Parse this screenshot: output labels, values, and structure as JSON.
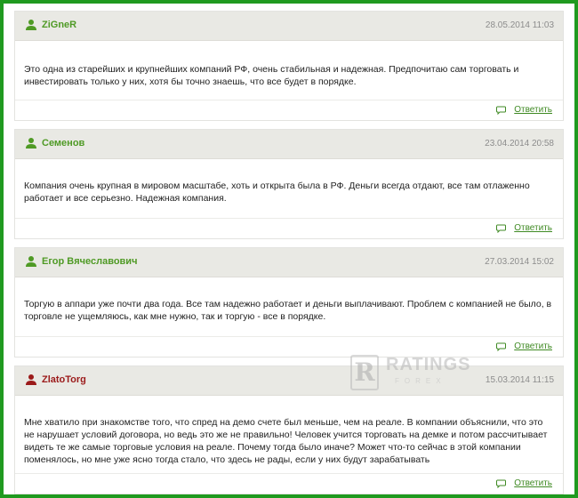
{
  "comments": [
    {
      "author": "ZiGneR",
      "date": "28.05.2014 11:03",
      "text": "Это одна из старейших и крупнейших компаний РФ, очень стабильная и надежная. Предпочитаю сам торговать и инвестировать только у них, хотя бы точно знаешь, что все будет в порядке.",
      "reply_label": "Ответить",
      "user_color": "#4f9a25"
    },
    {
      "author": "Семенов",
      "date": "23.04.2014 20:58",
      "text": "Компания очень крупная в мировом масштабе, хоть и открыта была в РФ. Деньги всегда отдают, все там отлаженно работает и все серьезно. Надежная компания.",
      "reply_label": "Ответить",
      "user_color": "#4f9a25"
    },
    {
      "author": "Егор Вячеславович",
      "date": "27.03.2014 15:02",
      "text": "Торгую в аппари уже почти два года. Все там надежно работает и деньги выплачивают. Проблем с компанией не было, в торговле не ущемляюсь, как мне нужно, так и торгую - все в порядке.",
      "reply_label": "Ответить",
      "user_color": "#4f9a25"
    },
    {
      "author": "ZlatoTorg",
      "date": "15.03.2014 11:15",
      "text": "Мне хватило при знакомстве того, что спред на демо счете был меньше, чем на реале. В компании объяснили, что это не нарушает условий договора, но ведь это же не правильно! Человек учится торговать на демке и потом рассчитывает видеть те же самые торговые условия на реале. Почему тогда было иначе? Может что-то сейчас в этой компании поменялось, но мне уже ясно тогда стало, что здесь не рады, если у них будут зарабатывать",
      "reply_label": "Ответить",
      "user_color": "#9b1a1a"
    }
  ],
  "watermark": {
    "main": "RATINGS",
    "sub": "FOREX",
    "mark": "R"
  },
  "colors": {
    "frame": "#1f9a1f",
    "header_bg": "#e9e9e4",
    "link": "#3f8a23"
  }
}
